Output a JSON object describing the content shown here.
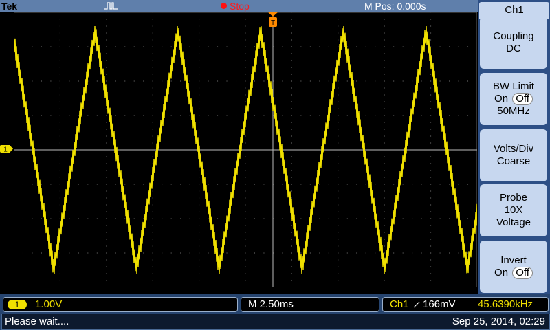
{
  "header": {
    "brand": "Tek",
    "run_state": "Stop",
    "m_pos": "M Pos: 0.000s"
  },
  "side_menu": {
    "title": "Ch1",
    "buttons": [
      {
        "line1": "Coupling",
        "line2": "DC"
      },
      {
        "line1": "BW Limit",
        "on_label": "On",
        "off_label": "Off",
        "selected": "Off",
        "line3": "50MHz"
      },
      {
        "line1": "Volts/Div",
        "line2": "Coarse"
      },
      {
        "line1": "Probe",
        "line2": "10X",
        "line3": "Voltage"
      },
      {
        "line1": "Invert",
        "on_label": "On",
        "off_label": "Off",
        "selected": "Off"
      }
    ]
  },
  "waveform": {
    "channel_marker": "1",
    "color": "#f0e000",
    "shape": "triangle",
    "periods_visible": 5.6
  },
  "status": {
    "channel_badge": "1",
    "volts_div": "1.00V",
    "timebase": "M 2.50ms",
    "trigger_source": "Ch1",
    "trigger_level": "166mV",
    "frequency": "45.6390kHz",
    "message": "Please wait....",
    "datetime": "Sep 25, 2014, 02:29"
  }
}
